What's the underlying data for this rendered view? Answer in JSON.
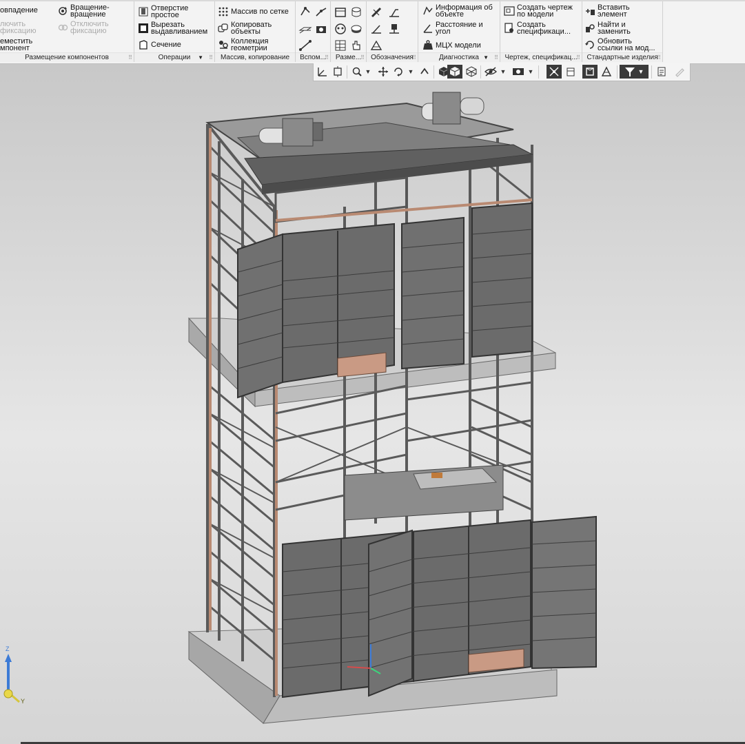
{
  "ribbon": {
    "groups": {
      "placement": {
        "label": "Размещение компонентов",
        "coincidence": "овпадение",
        "rotation_line1": "Вращение-",
        "rotation_line2": "вращение",
        "unfix_line1": "лючить",
        "unfix_line2": "фиксацию",
        "disable_fix_line1": "Отключить",
        "disable_fix_line2": "фиксацию",
        "move_line1": "еместить",
        "move_line2": "мпонент"
      },
      "operations": {
        "label": "Операции",
        "hole_line1": "Отверстие",
        "hole_line2": "простое",
        "cut_line1": "Вырезать",
        "cut_line2": "выдавливанием",
        "section": "Сечение"
      },
      "array": {
        "label": "Массив, копирование",
        "grid_array": "Массив по сетке",
        "copy_line1": "Копировать",
        "copy_line2": "объекты",
        "collection_line1": "Коллекция",
        "collection_line2": "геометрии"
      },
      "aux": {
        "label": "Вспом..."
      },
      "dims": {
        "label": "Разме..."
      },
      "notation": {
        "label": "Обозначения"
      },
      "diagnostics": {
        "label": "Диагностика",
        "info_line1": "Информация об",
        "info_line2": "объекте",
        "distance_line1": "Расстояние и",
        "distance_line2": "угол",
        "mcx": "МЦХ модели"
      },
      "drawing": {
        "label": "Чертеж, спецификац...",
        "create_drawing_line1": "Создать чертеж",
        "create_drawing_line2": "по модели",
        "create_spec_line1": "Создать",
        "create_spec_line2": "спецификаци..."
      },
      "standard": {
        "label": "Стандартные изделия",
        "insert_line1": "Вставить",
        "insert_line2": "элемент",
        "find_line1": "Найти и",
        "find_line2": "заменить",
        "update_line1": "Обновить",
        "update_line2": "ссылки на мод..."
      }
    }
  },
  "axes": {
    "z": "Z",
    "y": "Y"
  },
  "colors": {
    "ribbon_bg": "#f3f3f3",
    "viewport_top": "#c8c8c8",
    "viewport_bottom": "#e6e6e6",
    "steel": "#5a5a5a",
    "door": "#6b6b6b",
    "copper": "#b98a72",
    "concrete": "#b8b8b8",
    "axis_z": "#3c7bd6",
    "axis_x": "#d64b4b",
    "axis_y": "#d6c63c"
  }
}
